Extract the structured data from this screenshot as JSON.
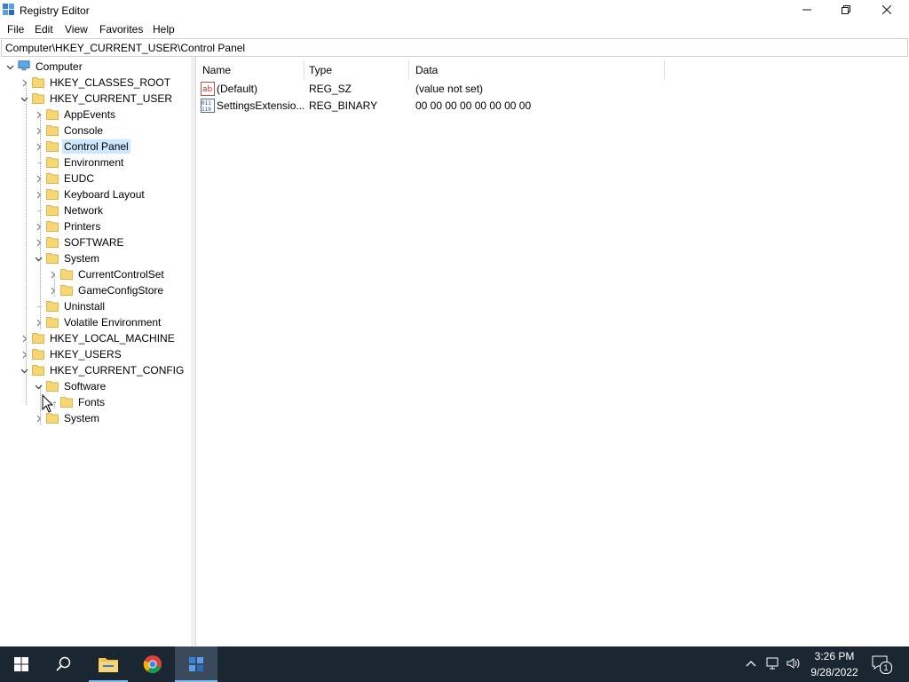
{
  "window": {
    "title": "Registry Editor",
    "minimize_icon": "minimize-icon",
    "restore_icon": "restore-icon",
    "close_icon": "close-icon"
  },
  "menu": [
    "File",
    "Edit",
    "View",
    "Favorites",
    "Help"
  ],
  "address": "Computer\\HKEY_CURRENT_USER\\Control Panel",
  "tree": [
    {
      "label": "Computer",
      "level": 0,
      "expander": "expanded",
      "icon": "computer-icon"
    },
    {
      "label": "HKEY_CLASSES_ROOT",
      "level": 1,
      "expander": "collapsed",
      "icon": "folder-icon"
    },
    {
      "label": "HKEY_CURRENT_USER",
      "level": 1,
      "expander": "expanded",
      "icon": "folder-icon"
    },
    {
      "label": "AppEvents",
      "level": 2,
      "expander": "collapsed",
      "icon": "folder-icon"
    },
    {
      "label": "Console",
      "level": 2,
      "expander": "collapsed",
      "icon": "folder-icon"
    },
    {
      "label": "Control Panel",
      "level": 2,
      "expander": "collapsed",
      "icon": "folder-icon",
      "selected": true
    },
    {
      "label": "Environment",
      "level": 2,
      "expander": "none",
      "icon": "folder-icon"
    },
    {
      "label": "EUDC",
      "level": 2,
      "expander": "collapsed",
      "icon": "folder-icon"
    },
    {
      "label": "Keyboard Layout",
      "level": 2,
      "expander": "collapsed",
      "icon": "folder-icon"
    },
    {
      "label": "Network",
      "level": 2,
      "expander": "none",
      "icon": "folder-icon"
    },
    {
      "label": "Printers",
      "level": 2,
      "expander": "collapsed",
      "icon": "folder-icon"
    },
    {
      "label": "SOFTWARE",
      "level": 2,
      "expander": "collapsed",
      "icon": "folder-icon"
    },
    {
      "label": "System",
      "level": 2,
      "expander": "expanded",
      "icon": "folder-icon"
    },
    {
      "label": "CurrentControlSet",
      "level": 3,
      "expander": "collapsed",
      "icon": "folder-icon"
    },
    {
      "label": "GameConfigStore",
      "level": 3,
      "expander": "collapsed",
      "icon": "folder-icon"
    },
    {
      "label": "Uninstall",
      "level": 2,
      "expander": "none",
      "icon": "folder-icon"
    },
    {
      "label": "Volatile Environment",
      "level": 2,
      "expander": "collapsed",
      "icon": "folder-icon"
    },
    {
      "label": "HKEY_LOCAL_MACHINE",
      "level": 1,
      "expander": "collapsed",
      "icon": "folder-icon"
    },
    {
      "label": "HKEY_USERS",
      "level": 1,
      "expander": "collapsed",
      "icon": "folder-icon"
    },
    {
      "label": "HKEY_CURRENT_CONFIG",
      "level": 1,
      "expander": "expanded",
      "icon": "folder-icon"
    },
    {
      "label": "Software",
      "level": 2,
      "expander": "expanded",
      "icon": "folder-icon"
    },
    {
      "label": "Fonts",
      "level": 3,
      "expander": "none",
      "icon": "folder-icon"
    },
    {
      "label": "System",
      "level": 2,
      "expander": "collapsed",
      "icon": "folder-icon"
    }
  ],
  "list": {
    "columns": [
      "Name",
      "Type",
      "Data"
    ],
    "rows": [
      {
        "name": "(Default)",
        "type": "REG_SZ",
        "data": "(value not set)",
        "icon": "string-value-icon"
      },
      {
        "name": "SettingsExtensio...",
        "type": "REG_BINARY",
        "data": "00 00 00 00 00 00 00 00",
        "icon": "binary-value-icon"
      }
    ]
  },
  "taskbar": {
    "items": [
      "start-icon",
      "search-icon",
      "file-explorer-icon",
      "chrome-icon",
      "registry-editor-icon"
    ],
    "active": "registry-editor-icon",
    "time": "3:26 PM",
    "date": "9/28/2022",
    "notification_count": "1",
    "tray_icons": [
      "chevron-up-icon",
      "network-icon",
      "volume-icon",
      "notification-icon"
    ]
  },
  "colors": {
    "taskbar": "#1b2633",
    "selection": "#cce8ff",
    "folder": "#f7d774",
    "accent": "#76b9ed"
  }
}
